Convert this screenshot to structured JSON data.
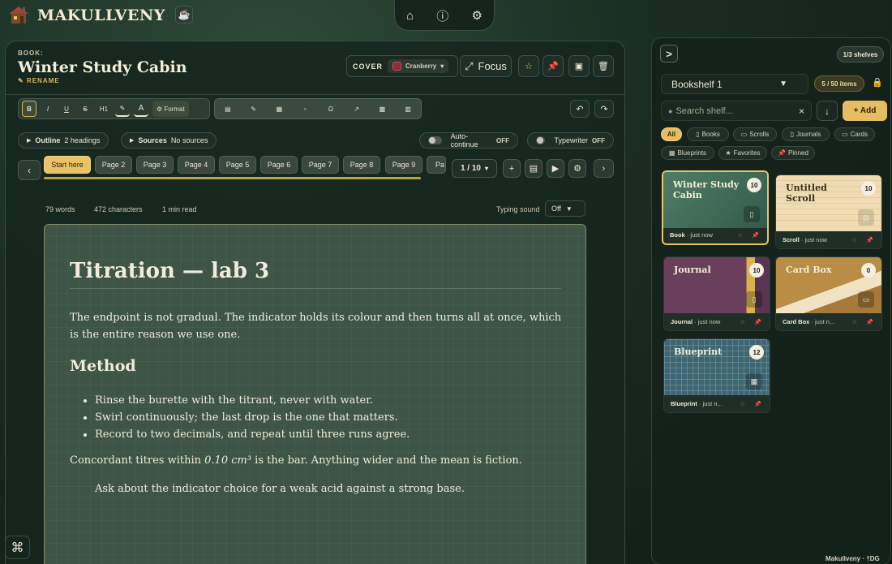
{
  "app": {
    "name": "MAKULLVENY"
  },
  "topnav": {
    "home_icon": "⌂",
    "info_icon": "ⓘ",
    "settings_icon": "⚙"
  },
  "editor": {
    "book_label": "BOOK:",
    "title": "Winter Study Cabin",
    "rename_label": "✎ RENAME",
    "cover_label": "COVER",
    "cover_value": "Cranberry",
    "focus_label": "Focus",
    "format_label": "⚙ Format",
    "toolbar": [
      "B",
      "I",
      "U",
      "S",
      "H1"
    ],
    "outline_label": "Outline",
    "outline_value": "2 headings",
    "sources_label": "Sources",
    "sources_value": "No sources",
    "auto_continue_label": "Auto-continue",
    "auto_continue_state": "OFF",
    "typewriter_label": "Typewriter",
    "typewriter_state": "OFF",
    "pages": [
      "Start here",
      "Page 2",
      "Page 3",
      "Page 4",
      "Page 5",
      "Page 6",
      "Page 7",
      "Page 8",
      "Page 9",
      "Pa"
    ],
    "page_counter": "1 / 10",
    "stats": {
      "words": "79 words",
      "characters": "472 characters",
      "read": "1 min read"
    },
    "typing_sound_label": "Typing sound",
    "typing_sound_value": "Off",
    "doc": {
      "h1": "Titration — lab 3",
      "p1": "The endpoint is not gradual. The indicator holds its colour and then turns all at once, which is the entire reason we use one.",
      "h2": "Method",
      "bullets": [
        "Rinse the burette with the titrant, never with water.",
        "Swirl continuously; the last drop is the one that matters.",
        "Record to two decimals, and repeat until three runs agree."
      ],
      "p2_before": "Concordant titres within ",
      "p2_em": "0.10 cm³",
      "p2_after": " is the bar. Anything wider and the mean is fiction.",
      "p3": "Ask about the indicator choice for a weak acid against a strong base."
    }
  },
  "shelf": {
    "toggle": ">",
    "shelves_count": "1/3 shelves",
    "selected_shelf": "Bookshelf 1",
    "items_count": "5 / 50 items",
    "search_placeholder": "Search shelf...",
    "add_label": "+ Add",
    "filters": [
      "All",
      "Books",
      "Scrolls",
      "Journals",
      "Cards",
      "Blueprints",
      "Favorites",
      "Pinned"
    ],
    "cards": [
      {
        "title": "Winter Study Cabin",
        "count": "10",
        "type": "Book",
        "time": "· just now",
        "selected": true
      },
      {
        "title": "Untitled Scroll",
        "count": "10",
        "type": "Scroll",
        "time": "· just now"
      },
      {
        "title": "Journal",
        "count": "10",
        "type": "Journal",
        "time": "· just now"
      },
      {
        "title": "Card Box",
        "count": "0",
        "type": "Card Box",
        "time": "· just n..."
      },
      {
        "title": "Blueprint",
        "count": "12",
        "type": "Blueprint",
        "time": "· just n..."
      }
    ]
  },
  "footer": {
    "brand": "Makullveny · †DG"
  },
  "colors": {
    "accent": "#e6bd63",
    "cover": "#8e2c39",
    "pin": "#e85d7c"
  }
}
